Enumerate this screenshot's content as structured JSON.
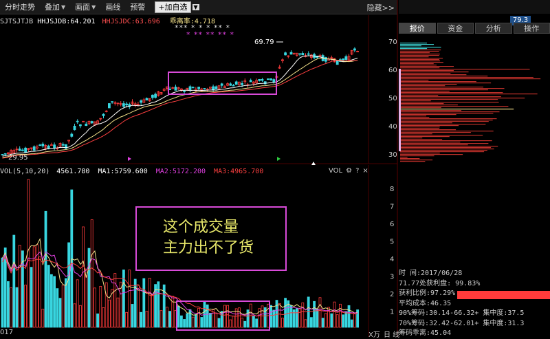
{
  "toolbar": {
    "items": [
      "分时走势",
      "叠加",
      "画面",
      "画线",
      "预警"
    ],
    "add_watch": "+加自选",
    "hide": "隐藏>>"
  },
  "top_price": "79.3",
  "indicator": {
    "a": "SJTSJTJB",
    "b": "HHJSJDB:64.201",
    "c": "HHJSJDC:63.696",
    "d": "乖离率:4.718"
  },
  "price_labels": {
    "high": "69.79",
    "low": "29.95"
  },
  "stars_top": "*** * * * ** *",
  "stars_pink": "* ** ** ** *",
  "vol_header": {
    "vol": "VOL(5,10,20)",
    "vol_value": "4561.780",
    "ma1": "MA1:5759.600",
    "ma2": "MA2:5172.200",
    "ma3": "MA3:4965.700"
  },
  "vol_icons": [
    "VOL",
    "⚙",
    "?",
    "×"
  ],
  "annotation": {
    "line1": "这个成交量",
    "line2": "主力出不了货"
  },
  "tabs": [
    "报价",
    "资金",
    "分析",
    "操作"
  ],
  "chip_axis": [
    "70",
    "60",
    "50",
    "40",
    "30"
  ],
  "vol_axis": [
    "8",
    "7",
    "6",
    "5",
    "4",
    "3",
    "2",
    "1"
  ],
  "vol_unit": "X万",
  "info": {
    "time": "时    间:2017/06/28",
    "profit_at": "71.77处获利盘: 99.83%",
    "profit_ratio": "获利比例:97.29%",
    "avg_cost": "平均成本:46.35",
    "chip90": "90%筹码:30.14-66.32+ 集中度:37.5",
    "chip70": "70%筹码:32.42-62.01+ 集中度:31.3",
    "chip_gap": "筹码乖离:45.04"
  },
  "bottom": {
    "year": "017",
    "period": "日 线"
  },
  "colors": {
    "up": "#ff3b3b",
    "down": "#38d6e0",
    "ma_white": "#ffffff",
    "ma_yellow": "#f5e28a",
    "ma_magenta": "#e040e0",
    "ma_red": "#ff4040",
    "annotation": "#e8e86a",
    "box": "#d84ad8"
  }
}
